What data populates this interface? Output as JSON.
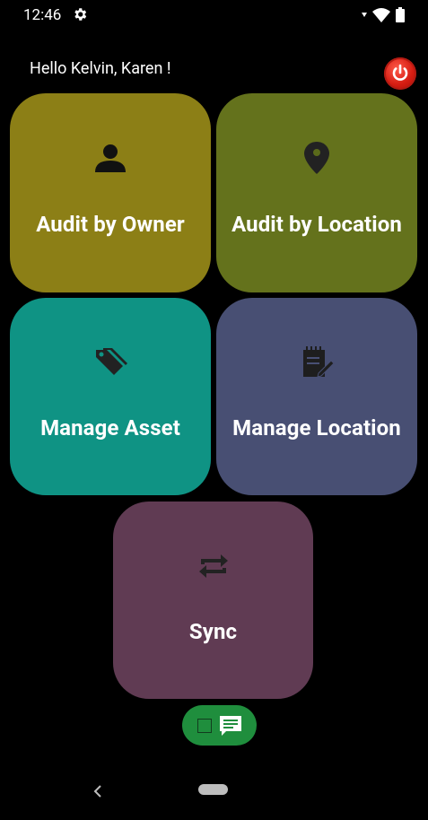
{
  "status_bar": {
    "time": "12:46",
    "icons": [
      "settings-icon",
      "wifi-icon",
      "battery-icon"
    ]
  },
  "header": {
    "greeting": "Hello Kelvin, Karen !",
    "power_icon": "power-icon",
    "power_color": "#d61d12"
  },
  "tiles": [
    {
      "label": "Audit by Owner",
      "icon": "person-icon",
      "color": "#8c7f16"
    },
    {
      "label": "Audit by Location",
      "icon": "location-pin-icon",
      "color": "#64721c"
    },
    {
      "label": "Manage Asset",
      "icon": "tags-icon",
      "color": "#0f9384"
    },
    {
      "label": "Manage Location",
      "icon": "notepad-edit-icon",
      "color": "#484f73"
    },
    {
      "label": "Sync",
      "icon": "sync-icon",
      "color": "#603b53"
    }
  ],
  "chat_button": {
    "icon": "chat-message-icon",
    "color": "#1f8e3d"
  },
  "nav_bar": {
    "back_icon": "back-chevron-icon",
    "home_icon": "home-pill-icon"
  }
}
